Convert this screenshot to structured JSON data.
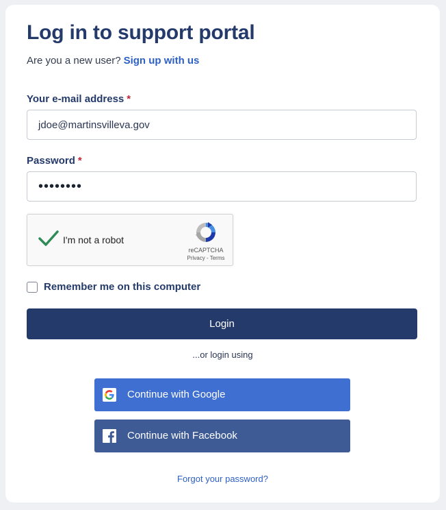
{
  "page": {
    "title": "Log in to support portal",
    "subtitle_text": "Are you a new user?",
    "signup_link": "Sign up with us"
  },
  "form": {
    "email_label": "Your e-mail address",
    "email_value": "jdoe@martinsvilleva.gov",
    "password_label": "Password",
    "password_value": "••••••••",
    "required_marker": "*",
    "remember_label": "Remember me on this computer",
    "remember_checked": false,
    "login_button": "Login"
  },
  "captcha": {
    "label": "I'm not a robot",
    "checked": true,
    "brand": "reCAPTCHA",
    "links": "Privacy - Terms"
  },
  "alt_login": {
    "divider_text": "...or login using",
    "google_label": "Continue with Google",
    "facebook_label": "Continue with Facebook"
  },
  "forgot_link": "Forgot your password?",
  "colors": {
    "primary": "#243a6b",
    "link": "#2d60c4",
    "google": "#3f6fd1",
    "facebook": "#3e5b96",
    "required": "#c0273a"
  },
  "icons": [
    "checkmark-icon",
    "recaptcha-logo-icon",
    "google-icon",
    "facebook-icon"
  ]
}
